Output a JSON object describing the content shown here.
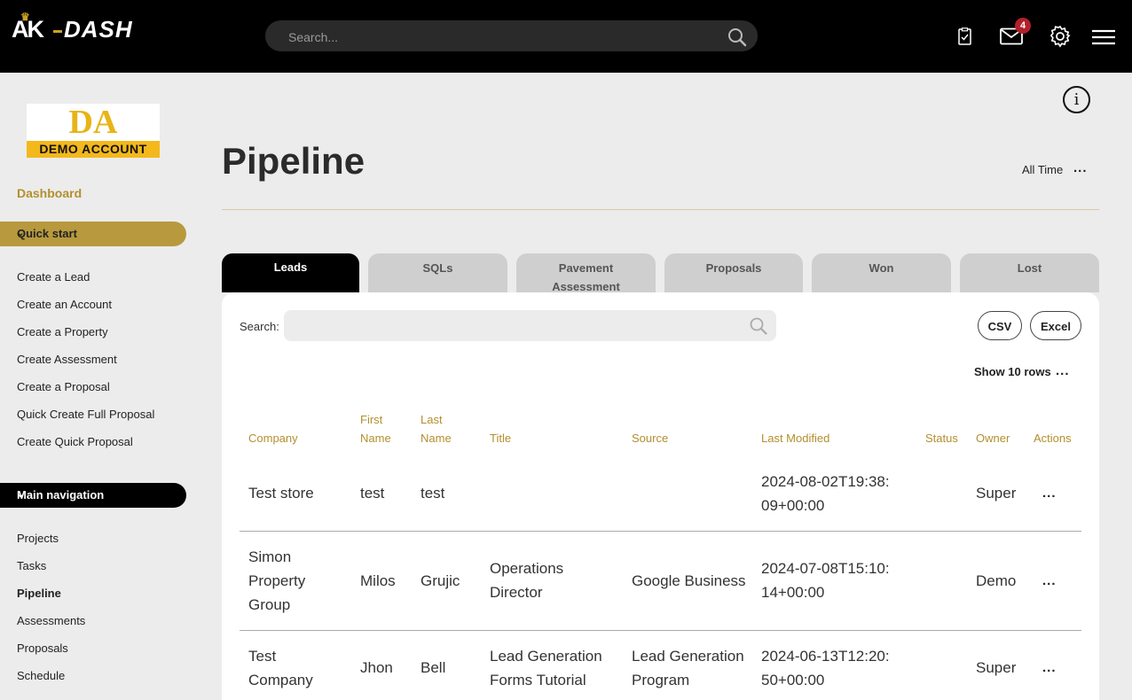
{
  "brand": {
    "ak": "AK",
    "dash": "DASH"
  },
  "top": {
    "search_placeholder": "Search...",
    "mail_badge": "4"
  },
  "sidebar": {
    "logo_top": "DA",
    "logo_bottom": "DEMO ACCOUNT",
    "dashboard": "Dashboard",
    "quick_start": "Quick start",
    "quick_items": [
      "Create a Lead",
      "Create an Account",
      "Create a Property",
      "Create Assessment",
      "Create a Proposal",
      "Quick Create Full Proposal",
      "Create Quick Proposal"
    ],
    "main_navigation": "Main navigation",
    "nav_items": [
      "Projects",
      "Tasks",
      "Pipeline",
      "Assessments",
      "Proposals",
      "Schedule"
    ]
  },
  "main": {
    "title": "Pipeline",
    "range": "All Time",
    "more": "...",
    "tabs": [
      "Leads",
      "SQLs",
      "Pavement Assessment",
      "Proposals",
      "Won",
      "Lost"
    ],
    "search_label": "Search:",
    "csv": "CSV",
    "excel": "Excel",
    "show_rows": "Show 10 rows"
  },
  "table": {
    "headers": [
      "Company",
      "First Name",
      "Last Name",
      "Title",
      "Source",
      "Last Modified",
      "Status",
      "Owner",
      "Actions"
    ],
    "rows": [
      {
        "company": "Test store",
        "first": "test",
        "last": "test",
        "title": "",
        "source": "",
        "modified": "2024-08-02T19:38:09+00:00",
        "status": "",
        "owner": "Super",
        "actions": "..."
      },
      {
        "company": "Simon Property Group",
        "first": "Milos",
        "last": "Grujic",
        "title": "Operations Director",
        "source": "Google Business",
        "modified": "2024-07-08T15:10:14+00:00",
        "status": "",
        "owner": "Demo",
        "actions": "..."
      },
      {
        "company": "Test Company",
        "first": "Jhon",
        "last": "Bell",
        "title": "Lead Generation Forms Tutorial",
        "source": "Lead Generation Program",
        "modified": "2024-06-13T12:20:50+00:00",
        "status": "",
        "owner": "Super",
        "actions": "..."
      }
    ]
  },
  "colors": {
    "accent": "#b38f2e",
    "quick_start_bg": "#b8993e",
    "topbar": "#000000",
    "badge": "#b3202a"
  }
}
